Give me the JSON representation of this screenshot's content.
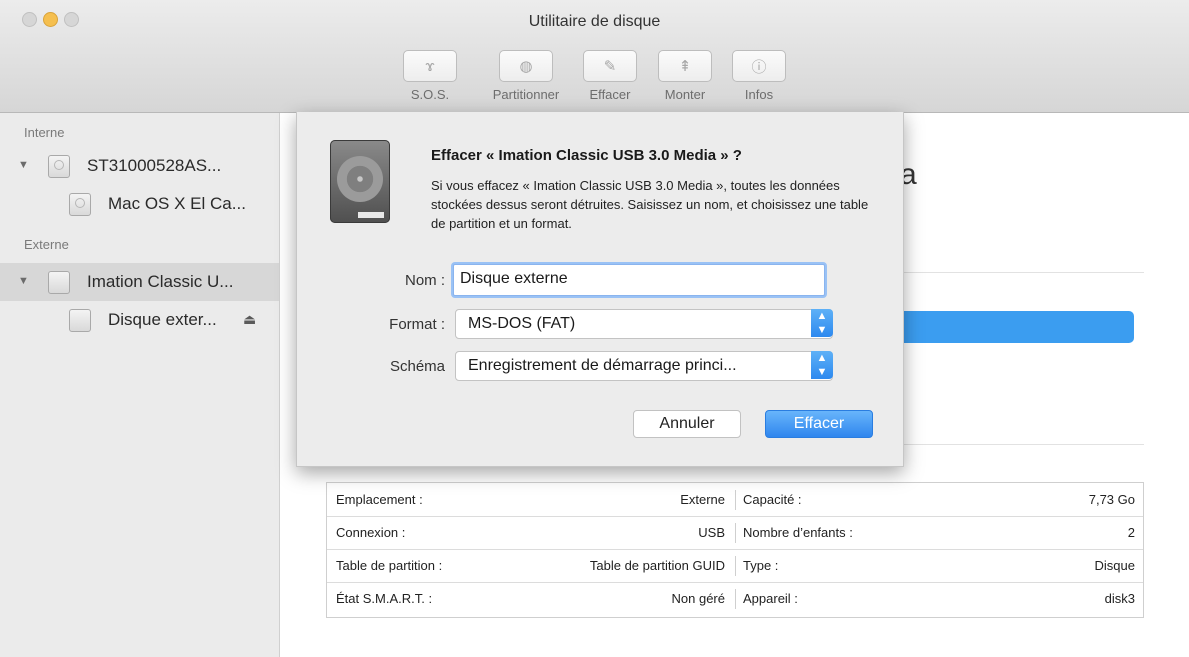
{
  "window": {
    "title": "Utilitaire de disque"
  },
  "toolbar": [
    {
      "label": "S.O.S.",
      "icon": "stethoscope-icon",
      "glyph": "ɤ"
    },
    {
      "label": "Partitionner",
      "icon": "partition-icon",
      "glyph": "◍"
    },
    {
      "label": "Effacer",
      "icon": "erase-icon",
      "glyph": "✎"
    },
    {
      "label": "Monter",
      "icon": "mount-icon",
      "glyph": "⇞"
    },
    {
      "label": "Infos",
      "icon": "info-icon",
      "glyph": "ⓘ"
    }
  ],
  "sidebar": {
    "internal_header": "Interne",
    "external_header": "Externe",
    "items": [
      {
        "label": "ST31000528AS..."
      },
      {
        "label": "Mac OS X El Ca..."
      },
      {
        "label": "Imation Classic U..."
      },
      {
        "label": "Disque exter..."
      }
    ]
  },
  "main": {
    "partial_name_char": "a",
    "info": [
      {
        "k1": "Emplacement :",
        "v1": "Externe",
        "k2": "Capacité :",
        "v2": "7,73 Go"
      },
      {
        "k1": "Connexion :",
        "v1": "USB",
        "k2": "Nombre d’enfants :",
        "v2": "2"
      },
      {
        "k1": "Table de partition :",
        "v1": "Table de partition GUID",
        "k2": "Type :",
        "v2": "Disque"
      },
      {
        "k1": "État S.M.A.R.T. :",
        "v1": "Non géré",
        "k2": "Appareil :",
        "v2": "disk3"
      }
    ]
  },
  "dialog": {
    "title": "Effacer « Imation Classic USB 3.0 Media » ?",
    "message": "Si vous effacez « Imation Classic USB 3.0 Media », toutes les données stockées dessus seront détruites. Saisissez un nom, et choisissez une table de partition et un format.",
    "name_label": "Nom :",
    "name_value": "Disque externe",
    "format_label": "Format :",
    "format_value": "MS-DOS (FAT)",
    "scheme_label": "Schéma",
    "scheme_value": "Enregistrement de démarrage princi...",
    "cancel_label": "Annuler",
    "erase_label": "Effacer"
  },
  "colors": {
    "accent": "#3b9df0",
    "sidebar_selection": "#d7d7d7"
  }
}
